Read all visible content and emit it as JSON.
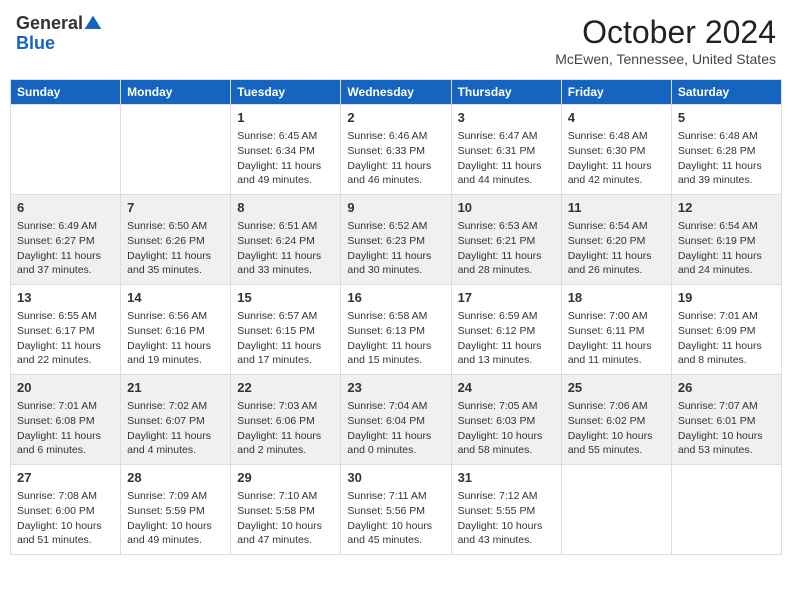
{
  "header": {
    "logo_general": "General",
    "logo_blue": "Blue",
    "month": "October 2024",
    "location": "McEwen, Tennessee, United States"
  },
  "days_of_week": [
    "Sunday",
    "Monday",
    "Tuesday",
    "Wednesday",
    "Thursday",
    "Friday",
    "Saturday"
  ],
  "weeks": [
    [
      {
        "day": "",
        "sunrise": "",
        "sunset": "",
        "daylight": ""
      },
      {
        "day": "",
        "sunrise": "",
        "sunset": "",
        "daylight": ""
      },
      {
        "day": "1",
        "sunrise": "Sunrise: 6:45 AM",
        "sunset": "Sunset: 6:34 PM",
        "daylight": "Daylight: 11 hours and 49 minutes."
      },
      {
        "day": "2",
        "sunrise": "Sunrise: 6:46 AM",
        "sunset": "Sunset: 6:33 PM",
        "daylight": "Daylight: 11 hours and 46 minutes."
      },
      {
        "day": "3",
        "sunrise": "Sunrise: 6:47 AM",
        "sunset": "Sunset: 6:31 PM",
        "daylight": "Daylight: 11 hours and 44 minutes."
      },
      {
        "day": "4",
        "sunrise": "Sunrise: 6:48 AM",
        "sunset": "Sunset: 6:30 PM",
        "daylight": "Daylight: 11 hours and 42 minutes."
      },
      {
        "day": "5",
        "sunrise": "Sunrise: 6:48 AM",
        "sunset": "Sunset: 6:28 PM",
        "daylight": "Daylight: 11 hours and 39 minutes."
      }
    ],
    [
      {
        "day": "6",
        "sunrise": "Sunrise: 6:49 AM",
        "sunset": "Sunset: 6:27 PM",
        "daylight": "Daylight: 11 hours and 37 minutes."
      },
      {
        "day": "7",
        "sunrise": "Sunrise: 6:50 AM",
        "sunset": "Sunset: 6:26 PM",
        "daylight": "Daylight: 11 hours and 35 minutes."
      },
      {
        "day": "8",
        "sunrise": "Sunrise: 6:51 AM",
        "sunset": "Sunset: 6:24 PM",
        "daylight": "Daylight: 11 hours and 33 minutes."
      },
      {
        "day": "9",
        "sunrise": "Sunrise: 6:52 AM",
        "sunset": "Sunset: 6:23 PM",
        "daylight": "Daylight: 11 hours and 30 minutes."
      },
      {
        "day": "10",
        "sunrise": "Sunrise: 6:53 AM",
        "sunset": "Sunset: 6:21 PM",
        "daylight": "Daylight: 11 hours and 28 minutes."
      },
      {
        "day": "11",
        "sunrise": "Sunrise: 6:54 AM",
        "sunset": "Sunset: 6:20 PM",
        "daylight": "Daylight: 11 hours and 26 minutes."
      },
      {
        "day": "12",
        "sunrise": "Sunrise: 6:54 AM",
        "sunset": "Sunset: 6:19 PM",
        "daylight": "Daylight: 11 hours and 24 minutes."
      }
    ],
    [
      {
        "day": "13",
        "sunrise": "Sunrise: 6:55 AM",
        "sunset": "Sunset: 6:17 PM",
        "daylight": "Daylight: 11 hours and 22 minutes."
      },
      {
        "day": "14",
        "sunrise": "Sunrise: 6:56 AM",
        "sunset": "Sunset: 6:16 PM",
        "daylight": "Daylight: 11 hours and 19 minutes."
      },
      {
        "day": "15",
        "sunrise": "Sunrise: 6:57 AM",
        "sunset": "Sunset: 6:15 PM",
        "daylight": "Daylight: 11 hours and 17 minutes."
      },
      {
        "day": "16",
        "sunrise": "Sunrise: 6:58 AM",
        "sunset": "Sunset: 6:13 PM",
        "daylight": "Daylight: 11 hours and 15 minutes."
      },
      {
        "day": "17",
        "sunrise": "Sunrise: 6:59 AM",
        "sunset": "Sunset: 6:12 PM",
        "daylight": "Daylight: 11 hours and 13 minutes."
      },
      {
        "day": "18",
        "sunrise": "Sunrise: 7:00 AM",
        "sunset": "Sunset: 6:11 PM",
        "daylight": "Daylight: 11 hours and 11 minutes."
      },
      {
        "day": "19",
        "sunrise": "Sunrise: 7:01 AM",
        "sunset": "Sunset: 6:09 PM",
        "daylight": "Daylight: 11 hours and 8 minutes."
      }
    ],
    [
      {
        "day": "20",
        "sunrise": "Sunrise: 7:01 AM",
        "sunset": "Sunset: 6:08 PM",
        "daylight": "Daylight: 11 hours and 6 minutes."
      },
      {
        "day": "21",
        "sunrise": "Sunrise: 7:02 AM",
        "sunset": "Sunset: 6:07 PM",
        "daylight": "Daylight: 11 hours and 4 minutes."
      },
      {
        "day": "22",
        "sunrise": "Sunrise: 7:03 AM",
        "sunset": "Sunset: 6:06 PM",
        "daylight": "Daylight: 11 hours and 2 minutes."
      },
      {
        "day": "23",
        "sunrise": "Sunrise: 7:04 AM",
        "sunset": "Sunset: 6:04 PM",
        "daylight": "Daylight: 11 hours and 0 minutes."
      },
      {
        "day": "24",
        "sunrise": "Sunrise: 7:05 AM",
        "sunset": "Sunset: 6:03 PM",
        "daylight": "Daylight: 10 hours and 58 minutes."
      },
      {
        "day": "25",
        "sunrise": "Sunrise: 7:06 AM",
        "sunset": "Sunset: 6:02 PM",
        "daylight": "Daylight: 10 hours and 55 minutes."
      },
      {
        "day": "26",
        "sunrise": "Sunrise: 7:07 AM",
        "sunset": "Sunset: 6:01 PM",
        "daylight": "Daylight: 10 hours and 53 minutes."
      }
    ],
    [
      {
        "day": "27",
        "sunrise": "Sunrise: 7:08 AM",
        "sunset": "Sunset: 6:00 PM",
        "daylight": "Daylight: 10 hours and 51 minutes."
      },
      {
        "day": "28",
        "sunrise": "Sunrise: 7:09 AM",
        "sunset": "Sunset: 5:59 PM",
        "daylight": "Daylight: 10 hours and 49 minutes."
      },
      {
        "day": "29",
        "sunrise": "Sunrise: 7:10 AM",
        "sunset": "Sunset: 5:58 PM",
        "daylight": "Daylight: 10 hours and 47 minutes."
      },
      {
        "day": "30",
        "sunrise": "Sunrise: 7:11 AM",
        "sunset": "Sunset: 5:56 PM",
        "daylight": "Daylight: 10 hours and 45 minutes."
      },
      {
        "day": "31",
        "sunrise": "Sunrise: 7:12 AM",
        "sunset": "Sunset: 5:55 PM",
        "daylight": "Daylight: 10 hours and 43 minutes."
      },
      {
        "day": "",
        "sunrise": "",
        "sunset": "",
        "daylight": ""
      },
      {
        "day": "",
        "sunrise": "",
        "sunset": "",
        "daylight": ""
      }
    ]
  ]
}
